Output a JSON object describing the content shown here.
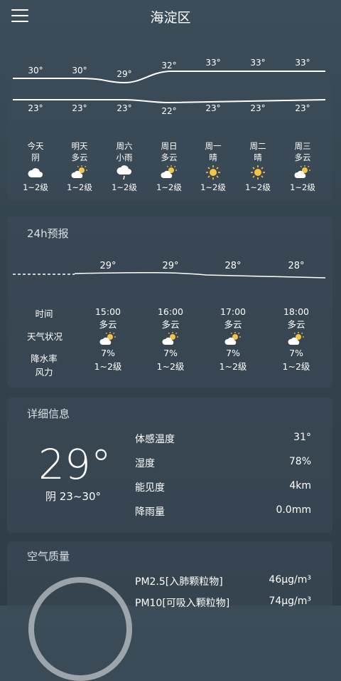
{
  "header": {
    "title": "海淀区"
  },
  "forecast": {
    "highs": [
      "30°",
      "30°",
      "29°",
      "32°",
      "33°",
      "33°",
      "33°"
    ],
    "lows": [
      "23°",
      "23°",
      "23°",
      "22°",
      "23°",
      "23°",
      "23°"
    ],
    "days": [
      {
        "day": "今天",
        "cond": "阴",
        "icon": "cloud-icon",
        "wind": "1~2级"
      },
      {
        "day": "明天",
        "cond": "多云",
        "icon": "partly-cloudy-icon",
        "wind": "1~2级"
      },
      {
        "day": "周六",
        "cond": "小雨",
        "icon": "light-rain-icon",
        "wind": "1~2级"
      },
      {
        "day": "周日",
        "cond": "多云",
        "icon": "partly-cloudy-icon",
        "wind": "1~2级"
      },
      {
        "day": "周一",
        "cond": "晴",
        "icon": "sun-icon",
        "wind": "1~2级"
      },
      {
        "day": "周二",
        "cond": "晴",
        "icon": "sun-icon",
        "wind": "1~2级"
      },
      {
        "day": "周三",
        "cond": "多云",
        "icon": "partly-cloudy-icon",
        "wind": "1~2级"
      }
    ]
  },
  "hourly": {
    "title": "24h预报",
    "temps": [
      "29°",
      "29°",
      "28°",
      "28°"
    ],
    "labels": {
      "time": "时间",
      "cond": "天气状况",
      "rain": "降水率",
      "wind": "风力"
    },
    "items": [
      {
        "time": "15:00",
        "cond": "多云",
        "icon": "partly-cloudy-icon",
        "rain": "7%",
        "wind": "1~2级"
      },
      {
        "time": "16:00",
        "cond": "多云",
        "icon": "partly-cloudy-icon",
        "rain": "7%",
        "wind": "1~2级"
      },
      {
        "time": "17:00",
        "cond": "多云",
        "icon": "partly-cloudy-icon",
        "rain": "7%",
        "wind": "1~2级"
      },
      {
        "time": "18:00",
        "cond": "多云",
        "icon": "partly-cloudy-icon",
        "rain": "7%",
        "wind": "1~2级"
      }
    ]
  },
  "details": {
    "title": "详细信息",
    "current_temp": "29°",
    "summary": "阴 23~30°",
    "rows": [
      {
        "label": "体感温度",
        "value": "31°"
      },
      {
        "label": "湿度",
        "value": "78%"
      },
      {
        "label": "能见度",
        "value": "4km"
      },
      {
        "label": "降雨量",
        "value": "0.0mm"
      }
    ]
  },
  "air": {
    "title": "空气质量",
    "rows": [
      {
        "label": "PM2.5[入肺颗粒物]",
        "value": "46μg/m³"
      },
      {
        "label": "PM10[可吸入颗粒物]",
        "value": "74μg/m³"
      }
    ]
  }
}
